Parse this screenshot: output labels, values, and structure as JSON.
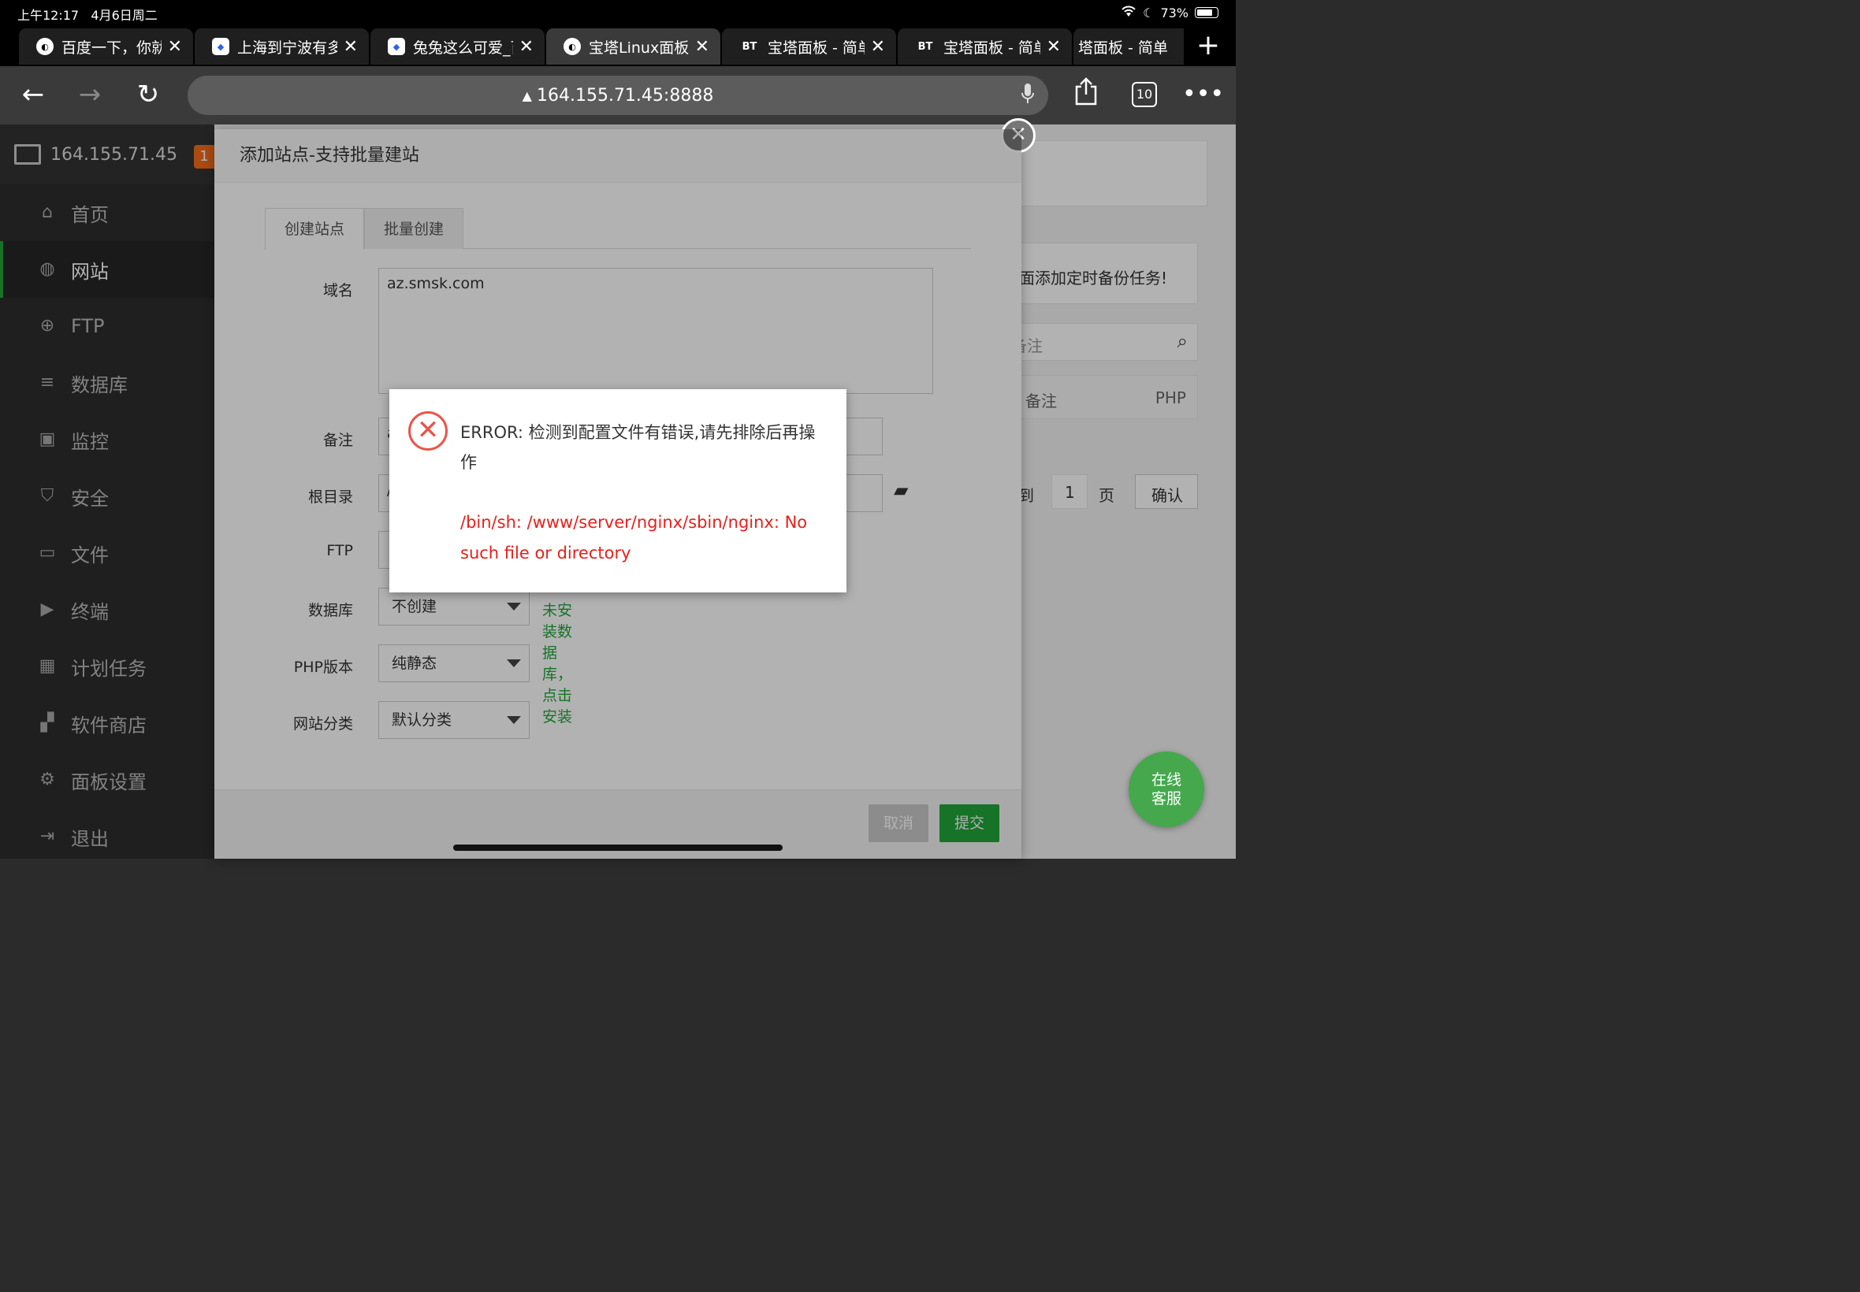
{
  "status_bar": {
    "time": "上午12:17",
    "date": "4月6日周二",
    "battery": "73%"
  },
  "tabs": [
    {
      "title": "百度一下，你就",
      "icon": "globe-icon",
      "active": false
    },
    {
      "title": "上海到宁波有多",
      "icon": "baidu-icon",
      "active": false
    },
    {
      "title": "兔兔这么可爱_百",
      "icon": "baidu-icon",
      "active": false
    },
    {
      "title": "宝塔Linux面板",
      "icon": "globe-icon",
      "active": true
    },
    {
      "title": "宝塔面板 - 简单",
      "icon": "bt-icon",
      "icon_text": "BT",
      "active": false
    },
    {
      "title": "宝塔面板 - 简单",
      "icon": "bt-icon",
      "icon_text": "BT",
      "active": false
    },
    {
      "title": "塔面板 - 简单",
      "icon": "bt-icon",
      "active": false
    }
  ],
  "nav": {
    "url": "164.155.71.45:8888",
    "tab_count": "10"
  },
  "sidebar": {
    "server": "164.155.71.45",
    "badge": "1",
    "items": [
      {
        "label": "首页",
        "icon": "home-icon",
        "glyph": "⌂"
      },
      {
        "label": "网站",
        "icon": "globe-icon",
        "glyph": "◍",
        "active": true
      },
      {
        "label": "FTP",
        "icon": "ftp-icon",
        "glyph": "⊕"
      },
      {
        "label": "数据库",
        "icon": "database-icon",
        "glyph": "≡"
      },
      {
        "label": "监控",
        "icon": "monitor-icon",
        "glyph": "▣"
      },
      {
        "label": "安全",
        "icon": "shield-icon",
        "glyph": "⛉"
      },
      {
        "label": "文件",
        "icon": "folder-icon",
        "glyph": "▭"
      },
      {
        "label": "终端",
        "icon": "terminal-icon",
        "glyph": "▶"
      },
      {
        "label": "计划任务",
        "icon": "calendar-icon",
        "glyph": "▦"
      },
      {
        "label": "软件商店",
        "icon": "apps-icon",
        "glyph": "▞"
      },
      {
        "label": "面板设置",
        "icon": "gear-icon",
        "glyph": "⚙"
      },
      {
        "label": "退出",
        "icon": "logout-icon",
        "glyph": "⇥"
      }
    ]
  },
  "background": {
    "notice": "面添加定时备份任务!",
    "search_placeholder": "备注",
    "col_remark": "备注",
    "col_php": "PHP",
    "goto_label": "跳到",
    "page_value": "1",
    "page_label": "页",
    "confirm": "确认"
  },
  "modal": {
    "title": "添加站点-支持批量建站",
    "tab_create": "创建站点",
    "tab_batch": "批量创建",
    "domain_label": "域名",
    "domain_value": "az.smsk.com",
    "remark_label": "备注",
    "remark_value": "a",
    "root_label": "根目录",
    "root_value": "/",
    "ftp_label": "FTP",
    "db_label": "数据库",
    "db_value": "不创建",
    "db_hint": "未安装数据库，点击安装",
    "php_label": "PHP版本",
    "php_value": "纯静态",
    "category_label": "网站分类",
    "category_value": "默认分类",
    "cancel": "取消",
    "submit": "提交"
  },
  "error": {
    "message": "ERROR: 检测到配置文件有错误,请先排除后再操作",
    "detail": "/bin/sh: /www/server/nginx/sbin/nginx: No such file or directory"
  },
  "chat": {
    "line1": "在线",
    "line2": "客服"
  }
}
